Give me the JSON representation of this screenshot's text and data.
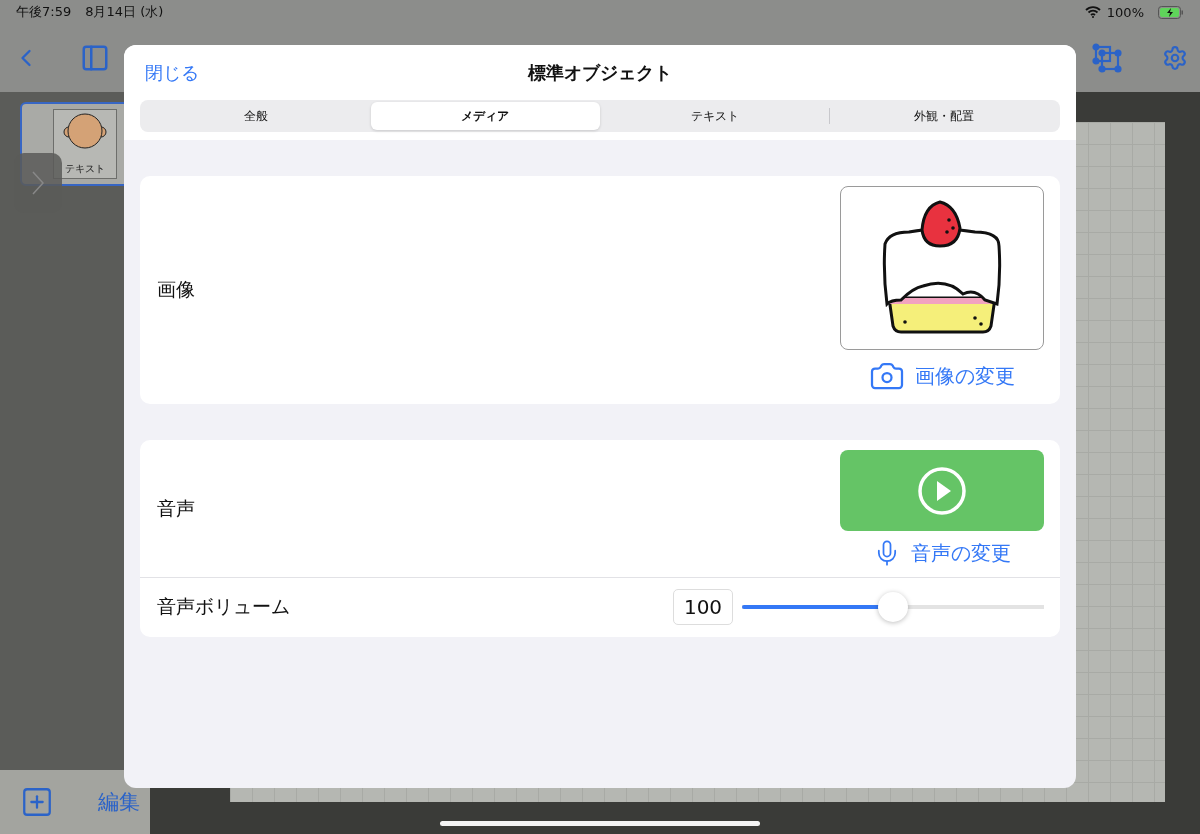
{
  "status_bar": {
    "time": "午後7:59",
    "date": "8月14日 (水)",
    "battery": "100%"
  },
  "sidebar": {
    "thumbnails": [
      {
        "label": "テキスト",
        "selected": true
      }
    ],
    "edit_button": "編集"
  },
  "dialog": {
    "close_button": "閉じる",
    "title": "標準オブジェクト",
    "tabs": [
      {
        "label": "全般",
        "selected": false
      },
      {
        "label": "メディア",
        "selected": true
      },
      {
        "label": "テキスト",
        "selected": false
      },
      {
        "label": "外観・配置",
        "selected": false
      }
    ],
    "image": {
      "label": "画像",
      "change_button": "画像の変更"
    },
    "sound": {
      "label": "音声",
      "change_button": "音声の変更"
    },
    "volume": {
      "label": "音声ボリューム",
      "value": "100",
      "level": 0.5
    }
  }
}
